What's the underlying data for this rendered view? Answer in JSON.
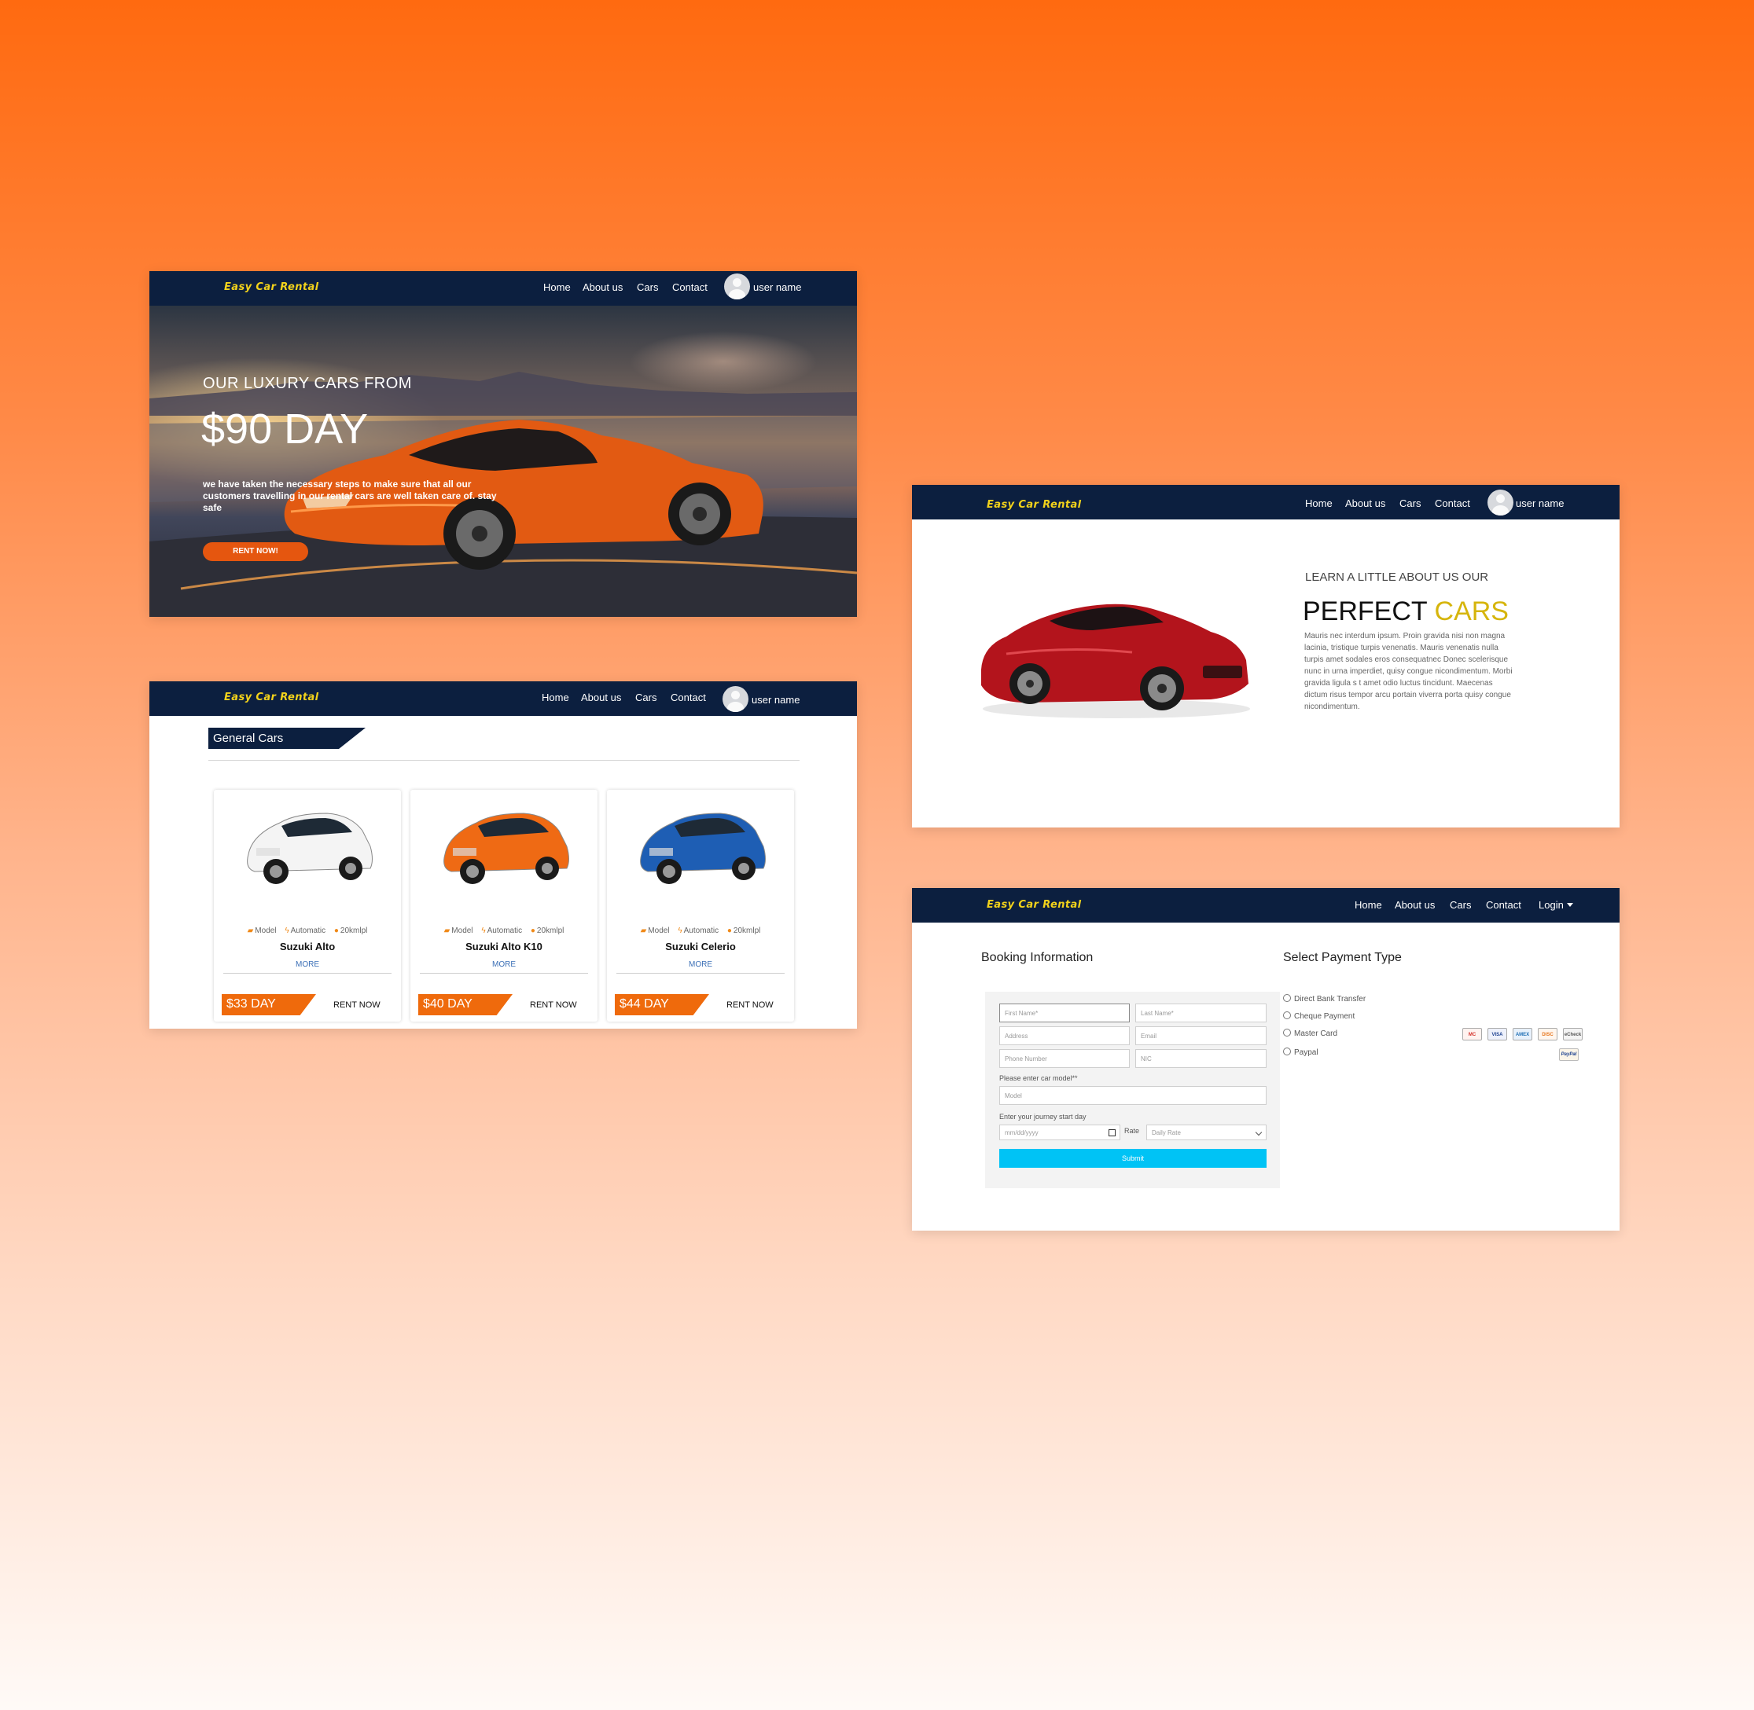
{
  "brand": "Easy Car Rental",
  "nav": {
    "home": "Home",
    "about": "About us",
    "cars": "Cars",
    "contact": "Contact",
    "user": "user name",
    "login": "Login"
  },
  "hero": {
    "lead": "OUR LUXURY CARS FROM",
    "price": "$90 DAY",
    "description": "we have taken the necessary steps to make sure that all our customers travelling in our rental cars are well taken care of. stay safe",
    "cta": "RENT NOW!"
  },
  "general_cars": {
    "title": "General Cars",
    "prev_icon": "chevron-left-icon",
    "next_icon": "chevron-right-icon",
    "cards": [
      {
        "name": "Suzuki Alto",
        "spec_model": "Model",
        "spec_trans": "Automatic",
        "spec_mileage": "20kmlpl",
        "more": "MORE",
        "price": "$33 DAY",
        "rent": "RENT NOW",
        "color": "#f4f4f4"
      },
      {
        "name": "Suzuki Alto K10",
        "spec_model": "Model",
        "spec_trans": "Automatic",
        "spec_mileage": "20kmlpl",
        "more": "MORE",
        "price": "$40 DAY",
        "rent": "RENT NOW",
        "color": "#ef6a14"
      },
      {
        "name": "Suzuki Celerio",
        "spec_model": "Model",
        "spec_trans": "Automatic",
        "spec_mileage": "20kmlpl",
        "more": "MORE",
        "price": "$44 DAY",
        "rent": "RENT NOW",
        "color": "#1e5eb4"
      }
    ]
  },
  "about": {
    "pre": "LEARN A LITTLE ABOUT US OUR",
    "title_main": "PERFECT ",
    "title_accent": "CARS",
    "text": "Mauris nec interdum ipsum. Proin gravida nisi non magna lacinia, tristique turpis venenatis. Mauris venenatis nulla turpis amet sodales eros consequatnec Donec scelerisque nunc in urna imperdiet, quisy congue nicondimentum. Morbi gravida ligula s t amet odio luctus tincidunt. Maecenas dictum risus tempor arcu portain viverra porta quisy congue nicondimentum."
  },
  "booking": {
    "title": "Booking Information",
    "first_name": "First Name*",
    "last_name": "Last Name*",
    "address": "Address",
    "email": "Email",
    "phone": "Phone Number",
    "nic": "NIC",
    "model_label": "Please enter car model**",
    "model": "Model",
    "date_label": "Enter your journey start day",
    "date": "mm/dd/yyyy",
    "rate_label": "Rate",
    "rate": "Daily Rate",
    "submit": "Submit"
  },
  "payment": {
    "title": "Select Payment Type",
    "options": [
      "Direct Bank Transfer",
      "Cheque Payment",
      "Master Card",
      "Paypal"
    ],
    "logos": [
      "MC",
      "VISA",
      "AMEX",
      "DISC",
      "eCheck"
    ],
    "paypal": "PayPal"
  },
  "colors": {
    "navbar": "#0c1f3f",
    "brand": "#f2d21b",
    "accent": "#ef6a0c",
    "cars_accent": "#d6b50c",
    "submit": "#00c3f5"
  }
}
